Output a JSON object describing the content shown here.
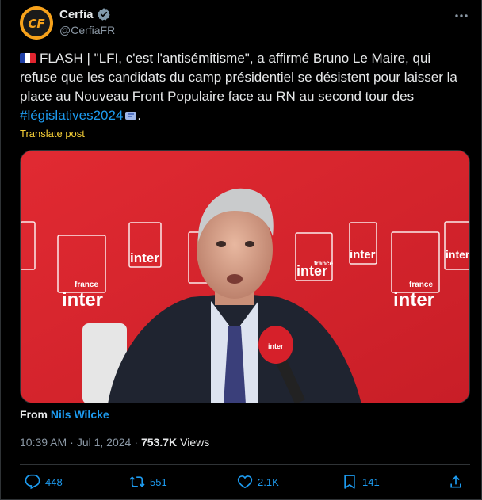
{
  "author": {
    "display_name": "Cerfia",
    "handle": "@CerfiaFR",
    "avatar_letters": "CF",
    "verified": true
  },
  "post": {
    "flag": "french-flag-icon",
    "text_main": "FLASH | \"LFI, c'est l'antisémitisme\", a affirmé Bruno Le Maire, qui refuse que les candidats du camp présidentiel se désistent pour laisser la place au Nouveau Front Populaire face au RN au second tour des ",
    "hashtag": "#législatives2024",
    "text_end": ".",
    "translate_label": "Translate post"
  },
  "media": {
    "kind": "video-frame",
    "background_brand": "france inter",
    "brand_word": "inter",
    "brand_top": "france"
  },
  "attribution": {
    "prefix": "From",
    "source": "Nils Wilcke"
  },
  "meta": {
    "time": "10:39 AM",
    "separator": "·",
    "date": "Jul 1, 2024",
    "separator2": "·",
    "views_count": "753.7K",
    "views_label": "Views"
  },
  "actions": {
    "replies": "448",
    "reposts": "551",
    "likes": "2.1K",
    "bookmarks": "141"
  },
  "colors": {
    "accent": "#1d9bf0",
    "translate": "#f7d038",
    "muted": "#8b98a5",
    "radio_red": "#d9242c"
  }
}
